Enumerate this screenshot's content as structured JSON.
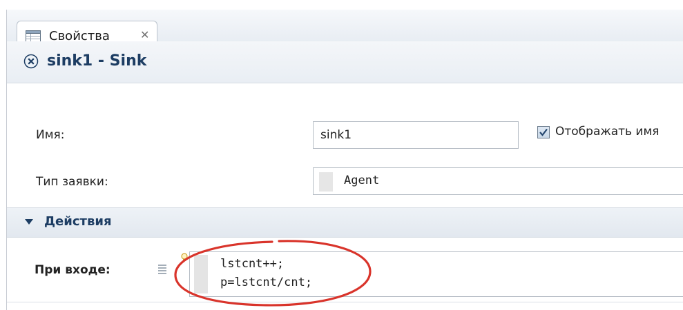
{
  "tab": {
    "label": "Свойства",
    "close_glyph": "✕",
    "icon": "properties-table-icon"
  },
  "header": {
    "title": "sink1 - Sink",
    "icon": "close-circle-icon"
  },
  "form": {
    "name_label": "Имя:",
    "name_value": "sink1",
    "show_name_checked": true,
    "show_name_label": "Отображать имя",
    "agent_type_label": "Тип заявки:",
    "agent_type_value": "Agent"
  },
  "actions_section": {
    "title": "Действия",
    "on_enter_label": "При входе:",
    "code_lines": [
      "lstcnt++;",
      "p=lstcnt/cnt;"
    ],
    "annotation_color": "#d9342b"
  },
  "colors": {
    "accent": "#1d3d63",
    "annotation": "#d9342b"
  }
}
